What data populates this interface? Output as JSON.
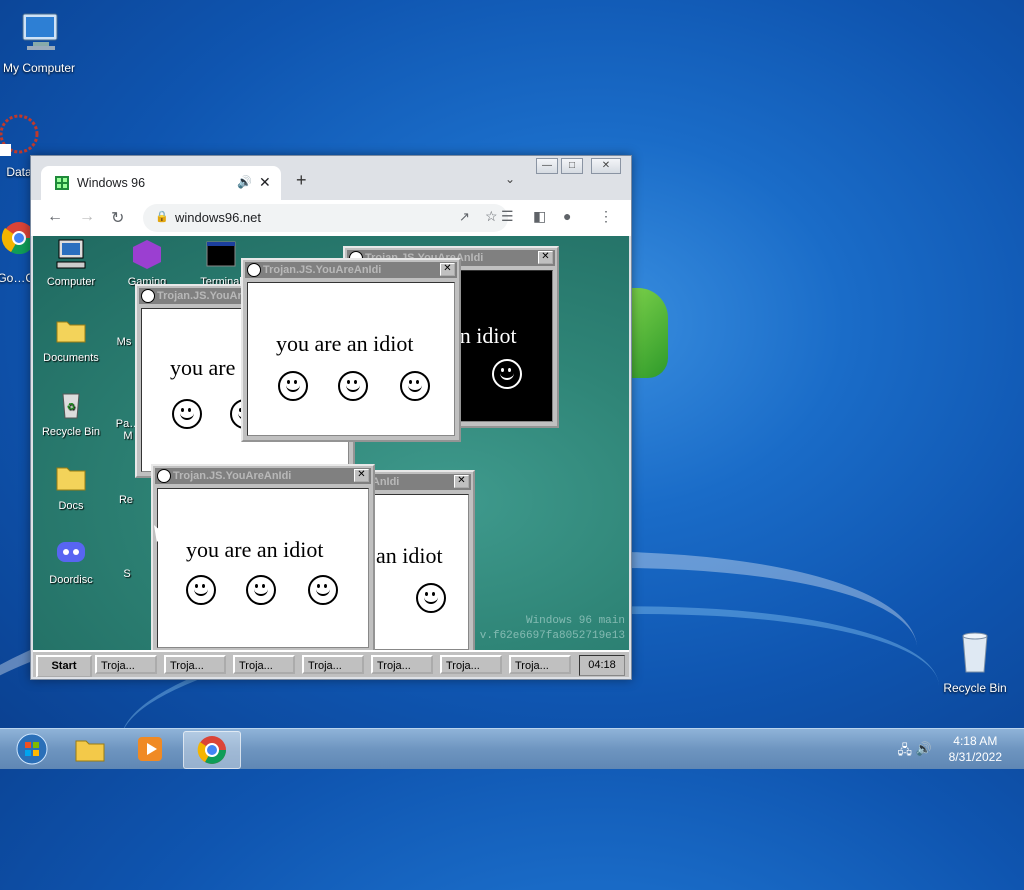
{
  "desktop": {
    "icons": [
      {
        "label": "My Computer",
        "icon": "computer-icon"
      },
      {
        "label": "Data",
        "icon": "data-icon"
      },
      {
        "label": "Go…Ch",
        "icon": "chrome-icon"
      },
      {
        "label": "Recycle Bin",
        "icon": "recycle-bin-icon"
      }
    ]
  },
  "browser": {
    "tab_title": "Windows 96",
    "url": "windows96.net",
    "new_tab": "+",
    "controls": {
      "minimize": "—",
      "maximize": "□",
      "close": "✕"
    }
  },
  "w96": {
    "icons": [
      {
        "label": "Computer"
      },
      {
        "label": "Gaming"
      },
      {
        "label": "Terminal"
      },
      {
        "label": "Documents"
      },
      {
        "label": "Ms"
      },
      {
        "label": "Recycle Bin"
      },
      {
        "label": "Pa… M"
      },
      {
        "label": "Docs"
      },
      {
        "label": "Re"
      },
      {
        "label": "Doordisc"
      },
      {
        "label": "S"
      }
    ],
    "popup_title": "Trojan.JS.YouAreAnIdi",
    "popup_text": "you are an idiot",
    "popup_text_partial1": "you are",
    "popup_text_partial2": "an idiot",
    "start": "Start",
    "task_items": [
      "Troja...",
      "Troja...",
      "Troja...",
      "Troja...",
      "Troja...",
      "Troja...",
      "Troja..."
    ],
    "clock": "04:18",
    "watermark_1": "Windows 96 main",
    "watermark_2": "v.f62e6697fa8052719e13"
  },
  "taskbar": {
    "time": "4:18 AM",
    "date": "8/31/2022",
    "pinned": [
      "start-orb",
      "file-explorer",
      "media-player",
      "chrome"
    ]
  }
}
